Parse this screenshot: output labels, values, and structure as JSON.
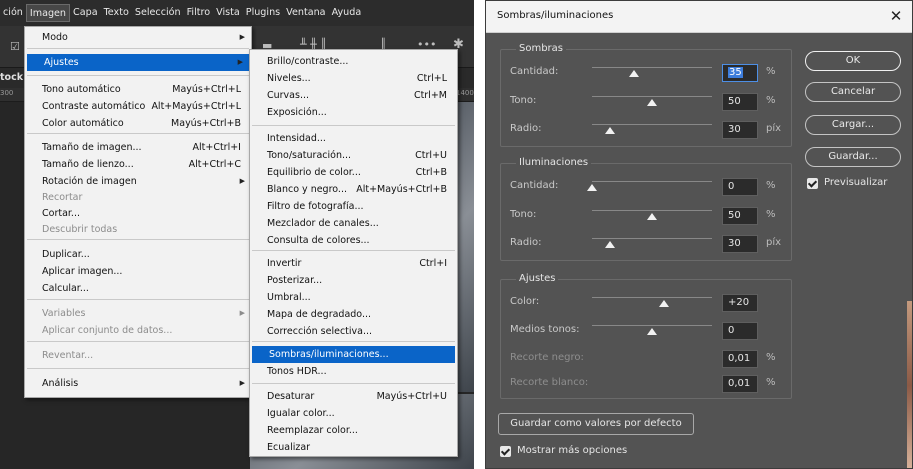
{
  "menubar": {
    "items": [
      "ción",
      "Imagen",
      "Capa",
      "Texto",
      "Selección",
      "Filtro",
      "Vista",
      "Plugins",
      "Ventana",
      "Ayuda"
    ]
  },
  "workspace": {
    "doc_tab_fragment": "tock",
    "ruler_left": "300",
    "ruler_right": "1400"
  },
  "image_menu": {
    "items": [
      {
        "label": "Modo",
        "shortcut": "",
        "submenu": true
      },
      {
        "label": "Ajustes",
        "shortcut": "",
        "submenu": true,
        "highlighted": true
      },
      {
        "label": "Tono automático",
        "shortcut": "Mayús+Ctrl+L"
      },
      {
        "label": "Contraste automático",
        "shortcut": "Alt+Mayús+Ctrl+L"
      },
      {
        "label": "Color automático",
        "shortcut": "Mayús+Ctrl+B"
      },
      {
        "label": "Tamaño de imagen...",
        "shortcut": "Alt+Ctrl+I"
      },
      {
        "label": "Tamaño de lienzo...",
        "shortcut": "Alt+Ctrl+C"
      },
      {
        "label": "Rotación de imagen",
        "shortcut": "",
        "submenu": true
      },
      {
        "label": "Recortar",
        "shortcut": "",
        "disabled": true
      },
      {
        "label": "Cortar...",
        "shortcut": ""
      },
      {
        "label": "Descubrir todas",
        "shortcut": "",
        "disabled": true
      },
      {
        "label": "Duplicar...",
        "shortcut": ""
      },
      {
        "label": "Aplicar imagen...",
        "shortcut": ""
      },
      {
        "label": "Calcular...",
        "shortcut": ""
      },
      {
        "label": "Variables",
        "shortcut": "",
        "submenu": true,
        "disabled": true
      },
      {
        "label": "Aplicar conjunto de datos...",
        "shortcut": "",
        "disabled": true
      },
      {
        "label": "Reventar...",
        "shortcut": "",
        "disabled": true
      },
      {
        "label": "Análisis",
        "shortcut": "",
        "submenu": true
      }
    ]
  },
  "adjustments_menu": {
    "items": [
      {
        "label": "Brillo/contraste...",
        "shortcut": ""
      },
      {
        "label": "Niveles...",
        "shortcut": "Ctrl+L"
      },
      {
        "label": "Curvas...",
        "shortcut": "Ctrl+M"
      },
      {
        "label": "Exposición...",
        "shortcut": ""
      },
      {
        "label": "Intensidad...",
        "shortcut": ""
      },
      {
        "label": "Tono/saturación...",
        "shortcut": "Ctrl+U"
      },
      {
        "label": "Equilibrio de color...",
        "shortcut": "Ctrl+B"
      },
      {
        "label": "Blanco y negro...",
        "shortcut": "Alt+Mayús+Ctrl+B"
      },
      {
        "label": "Filtro de fotografía...",
        "shortcut": ""
      },
      {
        "label": "Mezclador de canales...",
        "shortcut": ""
      },
      {
        "label": "Consulta de colores...",
        "shortcut": ""
      },
      {
        "label": "Invertir",
        "shortcut": "Ctrl+I"
      },
      {
        "label": "Posterizar...",
        "shortcut": ""
      },
      {
        "label": "Umbral...",
        "shortcut": ""
      },
      {
        "label": "Mapa de degradado...",
        "shortcut": ""
      },
      {
        "label": "Corrección selectiva...",
        "shortcut": ""
      },
      {
        "label": "Sombras/iluminaciones...",
        "shortcut": "",
        "selected": true
      },
      {
        "label": "Tonos HDR...",
        "shortcut": ""
      },
      {
        "label": "Desaturar",
        "shortcut": "Mayús+Ctrl+U"
      },
      {
        "label": "Igualar color...",
        "shortcut": ""
      },
      {
        "label": "Reemplazar color...",
        "shortcut": ""
      },
      {
        "label": "Ecualizar",
        "shortcut": ""
      }
    ]
  },
  "dialog": {
    "title": "Sombras/iluminaciones",
    "shadows": {
      "title": "Sombras",
      "amount": {
        "label": "Cantidad:",
        "value": "35",
        "unit": "%",
        "level": 0.35
      },
      "tone": {
        "label": "Tono:",
        "value": "50",
        "unit": "%",
        "level": 0.5
      },
      "radius": {
        "label": "Radio:",
        "value": "30",
        "unit": "píx",
        "level": 0.15
      }
    },
    "highlights": {
      "title": "Iluminaciones",
      "amount": {
        "label": "Cantidad:",
        "value": "0",
        "unit": "%",
        "level": 0.0
      },
      "tone": {
        "label": "Tono:",
        "value": "50",
        "unit": "%",
        "level": 0.5
      },
      "radius": {
        "label": "Radio:",
        "value": "30",
        "unit": "píx",
        "level": 0.15
      }
    },
    "adjustments": {
      "title": "Ajustes",
      "color": {
        "label": "Color:",
        "value": "+20",
        "unit": "",
        "level": 0.6
      },
      "midtones": {
        "label": "Medios tonos:",
        "value": "0",
        "unit": "",
        "level": 0.5
      },
      "black_clip": {
        "label": "Recorte negro:",
        "value": "0,01",
        "unit": "%"
      },
      "white_clip": {
        "label": "Recorte blanco:",
        "value": "0,01",
        "unit": "%"
      }
    },
    "buttons": {
      "ok": "OK",
      "cancel": "Cancelar",
      "load": "Cargar...",
      "save": "Guardar...",
      "save_default": "Guardar como valores por defecto"
    },
    "preview_label": "Previsualizar",
    "more_options_label": "Mostrar más opciones"
  }
}
